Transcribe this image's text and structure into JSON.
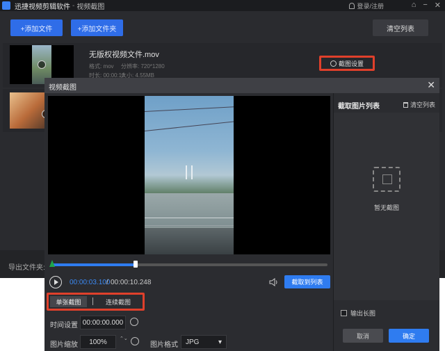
{
  "app": {
    "title": "迅捷视频剪辑软件",
    "separator": "-",
    "subtitle": "视频截图",
    "login": "登录/注册",
    "icons": [
      "home-icon",
      "minimize-icon",
      "close-icon"
    ]
  },
  "toolbar": {
    "add_file": "+添加文件",
    "add_folder": "+添加文件夹",
    "clear_list": "清空列表"
  },
  "file": {
    "name": "无版权视频文件.mov",
    "format": "格式: mov",
    "resolution": "分辨率: 720*1280",
    "duration": "时长: 00:00:10",
    "size": "大小: 4.55MB",
    "shot_settings": "截图设置"
  },
  "export": {
    "label": "导出文件夹:"
  },
  "dialog": {
    "title": "视频截图",
    "close": "✕",
    "player": {
      "current_time": "00:00:03.100",
      "separator": "/",
      "total_time": "00:00:10.248",
      "progress": 0.303,
      "capture_to_list": "截取到列表"
    },
    "tabs": {
      "single": "单张截图",
      "continuous": "连续截图"
    },
    "settings": {
      "time_label": "时间设置",
      "time_value": "00:00:00.000",
      "scale_label": "图片缩放",
      "scale_value": "100%",
      "stepper": "⌃⌄",
      "format_label": "图片格式",
      "format_value": "JPG",
      "format_caret": "▾"
    },
    "right_panel": {
      "title": "截取图片列表",
      "clear": "清空列表",
      "empty": "暂无截图",
      "long_image": "输出长图",
      "cancel": "取消",
      "ok": "确定"
    }
  },
  "colors": {
    "accent": "#2f7cf0",
    "highlight_box": "#e0402b",
    "start_marker": "#1fa64b"
  }
}
